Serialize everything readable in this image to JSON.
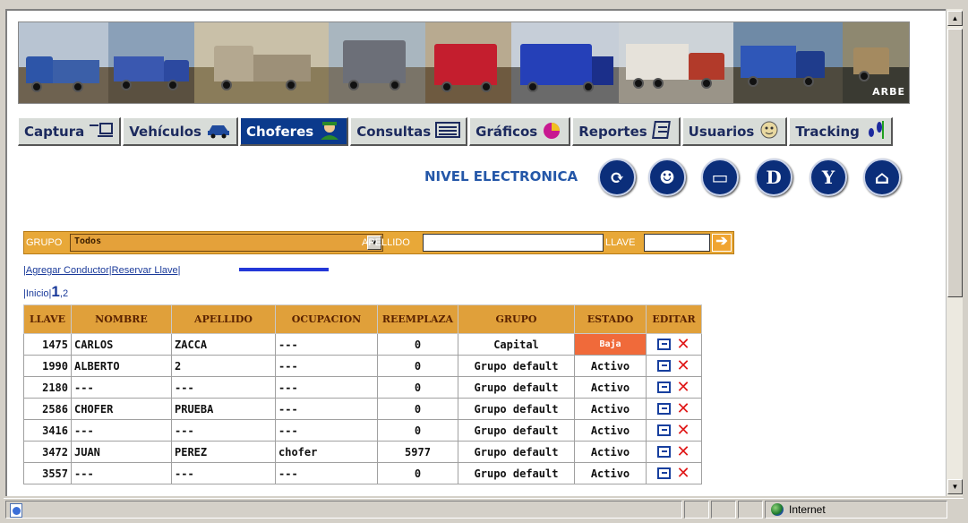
{
  "banner": {
    "logo_text": "ARBE"
  },
  "nav": {
    "tabs": [
      {
        "label": "Captura",
        "icon": "computer-icon"
      },
      {
        "label": "Vehículos",
        "icon": "car-icon"
      },
      {
        "label": "Choferes",
        "icon": "driver-icon",
        "active": true
      },
      {
        "label": "Consultas",
        "icon": "list-icon"
      },
      {
        "label": "Gráficos",
        "icon": "pie-chart-icon"
      },
      {
        "label": "Reportes",
        "icon": "report-icon"
      },
      {
        "label": "Usuarios",
        "icon": "user-icon"
      },
      {
        "label": "Tracking",
        "icon": "footprints-icon"
      }
    ]
  },
  "header": {
    "nivel_text": "NIVEL ELECTRONICA",
    "round_buttons": [
      {
        "name": "refresh-icon",
        "glyph": "⟳"
      },
      {
        "name": "owl-icon",
        "glyph": "☻"
      },
      {
        "name": "card-icon",
        "glyph": "▭"
      },
      {
        "name": "d-icon",
        "glyph": "D"
      },
      {
        "name": "wrench-icon",
        "glyph": "Y"
      },
      {
        "name": "home-icon",
        "glyph": "⌂"
      }
    ]
  },
  "filter": {
    "grupo_label": "GRUPO",
    "grupo_value": "Todos",
    "apellido_label": "APELLIDO",
    "apellido_value": "",
    "llave_label": "LLAVE",
    "llave_value": "",
    "go_glyph": "➔"
  },
  "actions": {
    "agregar": "|Agregar Conductor|",
    "reservar": "Reservar Llave|"
  },
  "pager": {
    "inicio": "|Inicio|",
    "current": "1",
    "sep": ",",
    "next": "2"
  },
  "table": {
    "headers": [
      "LLAVE",
      "NOMBRE",
      "APELLIDO",
      "OCUPACION",
      "REEMPLAZA",
      "GRUPO",
      "ESTADO",
      "EDITAR"
    ],
    "rows": [
      [
        "1475",
        "CARLOS",
        "ZACCA",
        "---",
        "0",
        "Capital",
        "Baja"
      ],
      [
        "1990",
        "ALBERTO",
        "2",
        "---",
        "0",
        "Grupo default",
        "Activo"
      ],
      [
        "2180",
        "---",
        "---",
        "---",
        "0",
        "Grupo default",
        "Activo"
      ],
      [
        "2586",
        "CHOFER",
        "PRUEBA",
        "---",
        "0",
        "Grupo default",
        "Activo"
      ],
      [
        "3416",
        "---",
        "---",
        "---",
        "0",
        "Grupo default",
        "Activo"
      ],
      [
        "3472",
        "JUAN",
        "PEREZ",
        "chofer",
        "5977",
        "Grupo default",
        "Activo"
      ],
      [
        "3557",
        "---",
        "---",
        "---",
        "0",
        "Grupo default",
        "Activo"
      ]
    ]
  },
  "statusbar": {
    "zone_text": "Internet"
  },
  "colors": {
    "accent_orange": "#e8a838",
    "nav_active": "#0b3a8c",
    "baja": "#f06a3a"
  }
}
